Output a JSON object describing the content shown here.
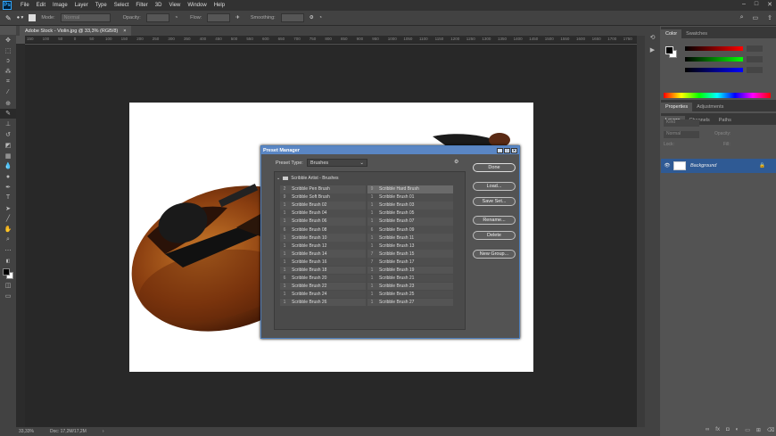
{
  "app": {
    "logo": "Ps"
  },
  "menu": [
    "File",
    "Edit",
    "Image",
    "Layer",
    "Type",
    "Select",
    "Filter",
    "3D",
    "View",
    "Window",
    "Help"
  ],
  "options": {
    "mode_label": "Mode:",
    "mode_value": "Normal",
    "opacity_label": "Opacity:",
    "flow_label": "Flow:",
    "smoothing_label": "Smoothing:"
  },
  "document": {
    "tab_title": "Adobe Stock - Violin.jpg @ 33,3% (RGB/8)",
    "close": "×"
  },
  "ruler_labels": [
    "150",
    "100",
    "50",
    "0",
    "50",
    "100",
    "150",
    "200",
    "250",
    "300",
    "350",
    "400",
    "450",
    "500",
    "550",
    "600",
    "650",
    "700",
    "750",
    "800",
    "850",
    "900",
    "950",
    "1000",
    "1050",
    "1100",
    "1150",
    "1200",
    "1250",
    "1300",
    "1350",
    "1400",
    "1450",
    "1500",
    "1550",
    "1600",
    "1650",
    "1700",
    "1750"
  ],
  "status": {
    "zoom": "33,33%",
    "doc": "Doc: 17,2M/17,2M"
  },
  "panels": {
    "color_tab": "Color",
    "swatches_tab": "Swatches",
    "properties_tab": "Properties",
    "adjustments_tab": "Adjustments",
    "layers_tab": "Layers",
    "channels_tab": "Channels",
    "paths_tab": "Paths",
    "kind": "Kind",
    "blend": "Normal",
    "opacity": "Opacity:",
    "lock": "Lock:",
    "fill": "Fill:",
    "layer_name": "Background"
  },
  "dialog": {
    "title": "Preset Manager",
    "preset_type_label": "Preset Type:",
    "preset_type_value": "Brushes",
    "group_name": "Scribble Artist - Brushes",
    "buttons": {
      "done": "Done",
      "load": "Load...",
      "save": "Save Set...",
      "rename": "Rename...",
      "delete": "Delete",
      "new_group": "New Group..."
    },
    "items": [
      {
        "n": "2",
        "name": "Scribble Pen Brush"
      },
      {
        "n": "9",
        "name": "Scribble Hard Brush"
      },
      {
        "n": "9",
        "name": "Scribble Soft Brush"
      },
      {
        "n": "1",
        "name": "Scribble Brush 01"
      },
      {
        "n": "1",
        "name": "Scribble Brush 02"
      },
      {
        "n": "1",
        "name": "Scribble Brush 03"
      },
      {
        "n": "1",
        "name": "Scribble Brush 04"
      },
      {
        "n": "1",
        "name": "Scribble Brush 05"
      },
      {
        "n": "1",
        "name": "Scribble Brush 06"
      },
      {
        "n": "1",
        "name": "Scribble Brush 07"
      },
      {
        "n": "6",
        "name": "Scribble Brush 08"
      },
      {
        "n": "6",
        "name": "Scribble Brush 09"
      },
      {
        "n": "1",
        "name": "Scribble Brush 10"
      },
      {
        "n": "1",
        "name": "Scribble Brush 11"
      },
      {
        "n": "1",
        "name": "Scribble Brush 12"
      },
      {
        "n": "1",
        "name": "Scribble Brush 13"
      },
      {
        "n": "1",
        "name": "Scribble Brush 14"
      },
      {
        "n": "7",
        "name": "Scribble Brush 15"
      },
      {
        "n": "1",
        "name": "Scribble Brush 16"
      },
      {
        "n": "7",
        "name": "Scribble Brush 17"
      },
      {
        "n": "1",
        "name": "Scribble Brush 18"
      },
      {
        "n": "1",
        "name": "Scribble Brush 19"
      },
      {
        "n": "6",
        "name": "Scribble Brush 20"
      },
      {
        "n": "1",
        "name": "Scribble Brush 21"
      },
      {
        "n": "1",
        "name": "Scribble Brush 22"
      },
      {
        "n": "1",
        "name": "Scribble Brush 23"
      },
      {
        "n": "1",
        "name": "Scribble Brush 24"
      },
      {
        "n": "1",
        "name": "Scribble Brush 25"
      },
      {
        "n": "1",
        "name": "Scribble Brush 26"
      },
      {
        "n": "1",
        "name": "Scribble Brush 27"
      }
    ]
  }
}
